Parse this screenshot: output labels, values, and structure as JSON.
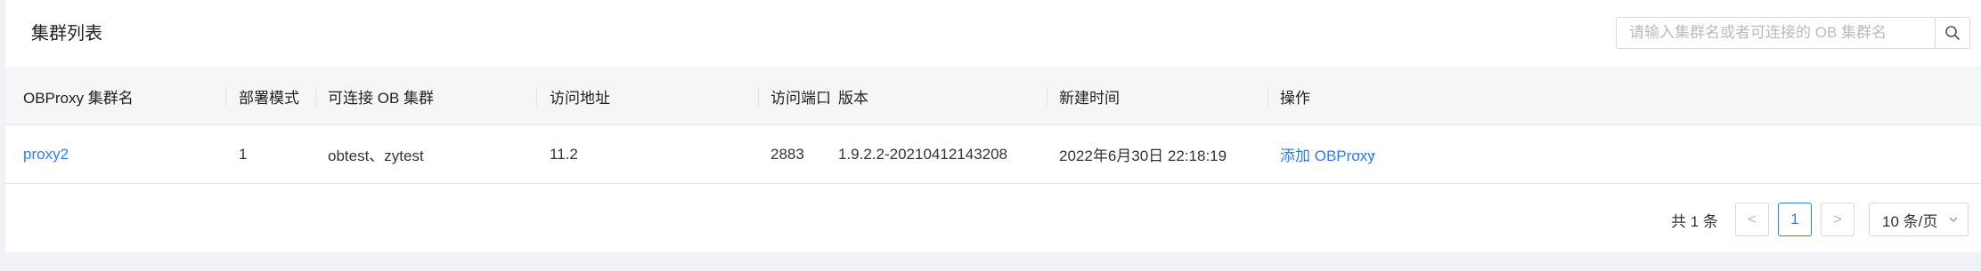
{
  "page": {
    "title": "集群列表"
  },
  "search": {
    "placeholder": "请输入集群名或者可连接的 OB 集群名",
    "icon": "search-icon"
  },
  "table": {
    "columns": [
      "OBProxy 集群名",
      "部署模式",
      "可连接 OB 集群",
      "访问地址",
      "访问端口",
      "版本",
      "新建时间",
      "操作"
    ],
    "rows": [
      {
        "name": "proxy2",
        "mode": "1",
        "ob_clusters": "obtest、zytest",
        "address": "11.2",
        "port": "2883",
        "version": "1.9.2.2-20210412143208",
        "created": "2022年6月30日 22:18:19",
        "action_add": "添加 OBProxy",
        "action_more": "···"
      }
    ]
  },
  "pagination": {
    "total_text": "共 1 条",
    "prev": "<",
    "current_page": "1",
    "next": ">",
    "page_size": "10 条/页"
  },
  "colors": {
    "accent": "#2e7df6",
    "header_bg": "#f5f6f8",
    "page_bg": "#f0f2f7"
  }
}
